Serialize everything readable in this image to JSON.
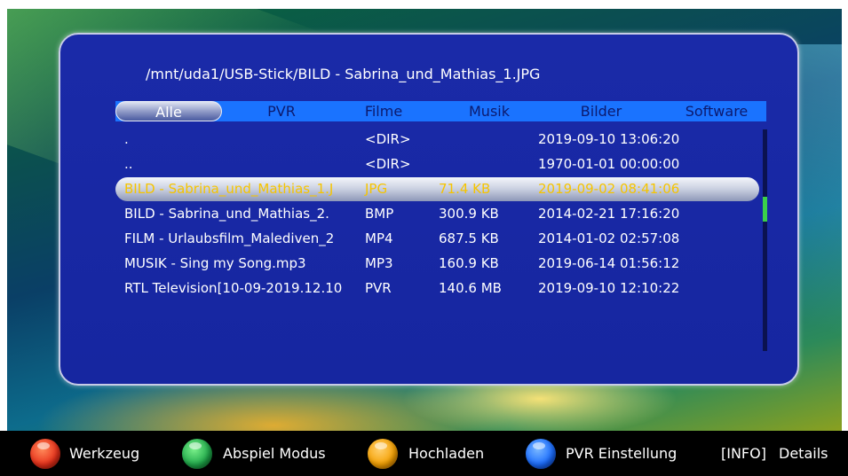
{
  "path": "/mnt/uda1/USB-Stick/BILD - Sabrina_und_Mathias_1.JPG",
  "tabs": [
    {
      "label": "Alle",
      "active": true
    },
    {
      "label": "PVR"
    },
    {
      "label": "Filme"
    },
    {
      "label": "Musik"
    },
    {
      "label": "Bilder"
    },
    {
      "label": "Software"
    }
  ],
  "files": [
    {
      "name": ".",
      "type": "<DIR>",
      "size": "",
      "date": "2019-09-10 13:06:20"
    },
    {
      "name": "..",
      "type": "<DIR>",
      "size": "",
      "date": "1970-01-01 00:00:00"
    },
    {
      "name": "BILD - Sabrina_und_Mathias_1.J",
      "type": "JPG",
      "size": "71.4 KB",
      "date": "2019-09-02 08:41:06",
      "selected": true
    },
    {
      "name": "BILD - Sabrina_und_Mathias_2.",
      "type": "BMP",
      "size": "300.9 KB",
      "date": "2014-02-21 17:16:20"
    },
    {
      "name": "FILM - Urlaubsfilm_Malediven_2",
      "type": "MP4",
      "size": "687.5 KB",
      "date": "2014-01-02 02:57:08"
    },
    {
      "name": "MUSIK - Sing my Song.mp3",
      "type": "MP3",
      "size": "160.9 KB",
      "date": "2019-06-14 01:56:12"
    },
    {
      "name": "RTL Television[10-09-2019.12.10",
      "type": "PVR",
      "size": "140.6 MB",
      "date": "2019-09-10 12:10:22"
    }
  ],
  "footer": {
    "red": "Werkzeug",
    "green": "Abspiel Modus",
    "yellow": "Hochladen",
    "blue": "PVR Einstellung",
    "info_key": "[INFO]",
    "info_label": "Details"
  },
  "colors": {
    "red": "#e8301a",
    "green": "#1fa84a",
    "yellow": "#f5a000",
    "blue": "#1a6cff",
    "highlight_text": "#f5c400"
  }
}
